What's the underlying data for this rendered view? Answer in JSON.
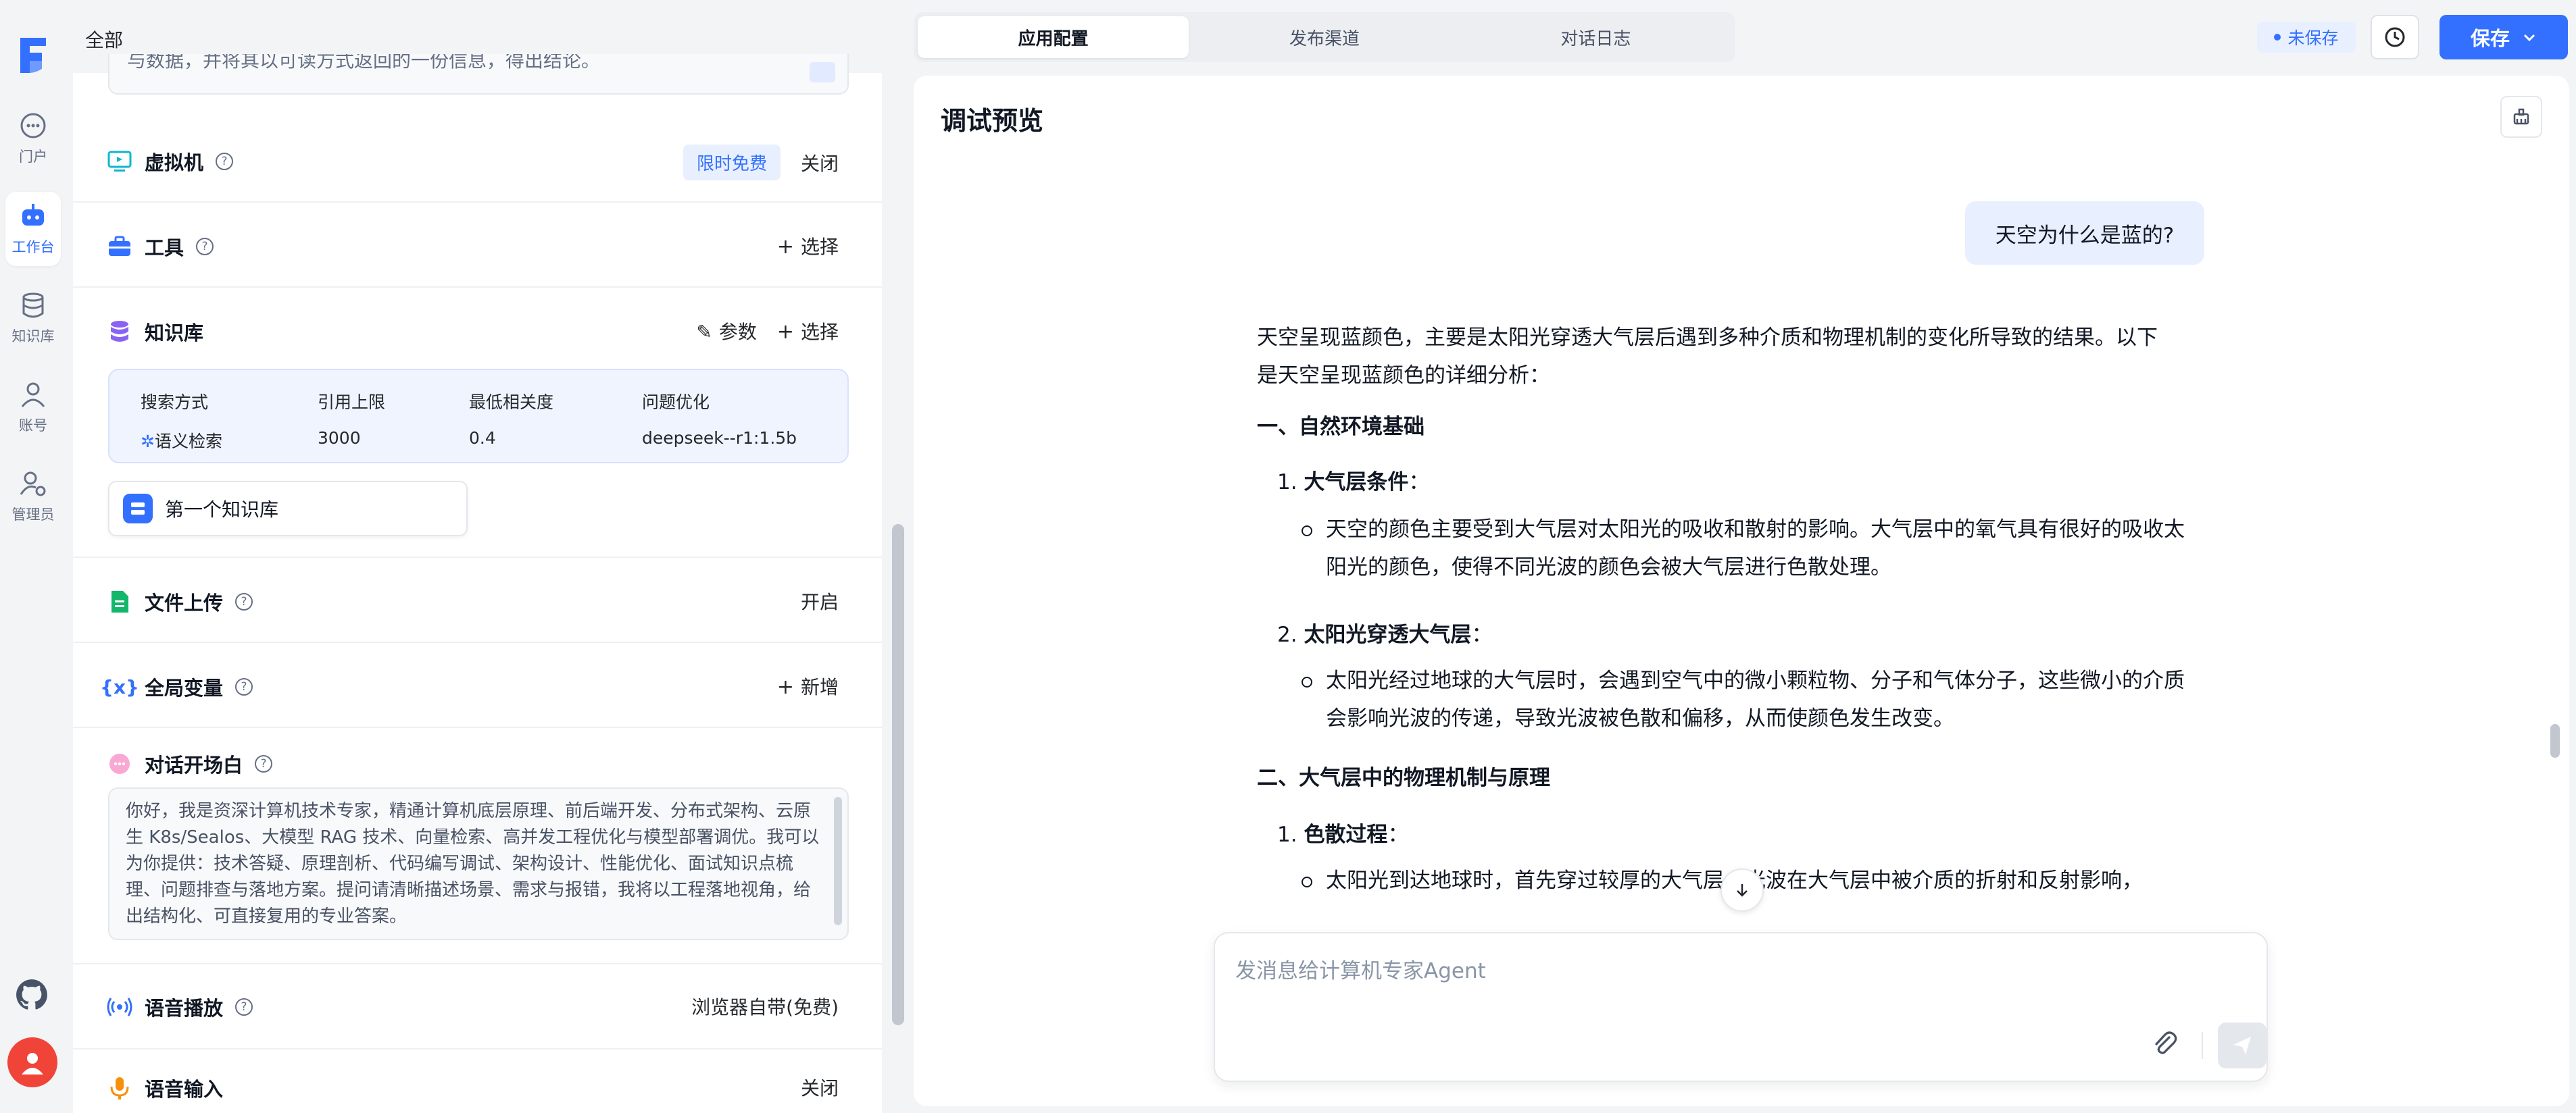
{
  "nav": {
    "items": [
      {
        "label": "门户",
        "icon": "chat-bubble-icon"
      },
      {
        "label": "工作台",
        "icon": "robot-icon"
      },
      {
        "label": "知识库",
        "icon": "database-icon"
      },
      {
        "label": "账号",
        "icon": "user-icon"
      },
      {
        "label": "管理员",
        "icon": "admin-gear-icon"
      }
    ],
    "active_index": 1
  },
  "config": {
    "breadcrumb": "全部",
    "cut_text": "与数据，并将其以可读方式返回的一份信息，得出结论。",
    "vm": {
      "title": "虚拟机",
      "badge": "限时免费",
      "action": "关闭"
    },
    "tools": {
      "title": "工具",
      "action": "选择"
    },
    "kb": {
      "title": "知识库",
      "param": "参数",
      "action": "选择",
      "headers": [
        "搜索方式",
        "引用上限",
        "最低相关度",
        "问题优化"
      ],
      "row": [
        "语义检索",
        "3000",
        "0.4",
        "deepseek--r1:1.5b"
      ],
      "selected": "第一个知识库"
    },
    "file_upload": {
      "title": "文件上传",
      "action": "开启"
    },
    "globals": {
      "title": "全局变量",
      "action": "新增"
    },
    "welcome": {
      "title": "对话开场白",
      "text": "你好，我是资深计算机技术专家，精通计算机底层原理、前后端开发、分布式架构、云原生 K8s/Sealos、大模型 RAG 技术、向量检索、高并发工程优化与模型部署调优。我可以为你提供：技术答疑、原理剖析、代码编写调试、架构设计、性能优化、面试知识点梳理、问题排查与落地方案。提问请清晰描述场景、需求与报错，我将以工程落地视角，给出结构化、可直接复用的专业答案。"
    },
    "tts": {
      "title": "语音播放",
      "action": "浏览器自带(免费)"
    },
    "stt": {
      "title": "语音输入",
      "action": "关闭"
    }
  },
  "tabs": [
    "应用配置",
    "发布渠道",
    "对话日志"
  ],
  "active_tab": 0,
  "header": {
    "unsaved": "未保存",
    "save": "保存"
  },
  "chat": {
    "title": "调试预览",
    "user_message": "天空为什么是蓝的?",
    "answer": {
      "intro_1": "天空呈现蓝颜色，主要是太阳光穿透大气层后遇到多种介质和物理机制的变化所导致的结果。以下",
      "intro_2": "是天空呈现蓝颜色的详细分析：",
      "h1": "一、自然环境基础",
      "item1": "大气层条件",
      "item1_text": "天空的颜色主要受到大气层对太阳光的吸收和散射的影响。大气层中的氧气具有很好的吸收太阳光的颜色，使得不同光波的颜色会被大气层进行色散处理。",
      "item2": "太阳光穿透大气层",
      "item2_text": "太阳光经过地球的大气层时，会遇到空气中的微小颗粒物、分子和气体分子，这些微小的介质会影响光波的传递，导致光波被色散和偏移，从而使颜色发生改变。",
      "h2": "二、大气层中的物理机制与原理",
      "item3": "色散过程",
      "item3_text": "太阳光到达地球时，首先穿过较厚的大气层，光波在大气层中被介质的折射和反射影响，"
    },
    "input_placeholder": "发消息给计算机专家Agent"
  },
  "colors": {
    "accent": "#3370ff",
    "danger": "#f04438"
  }
}
